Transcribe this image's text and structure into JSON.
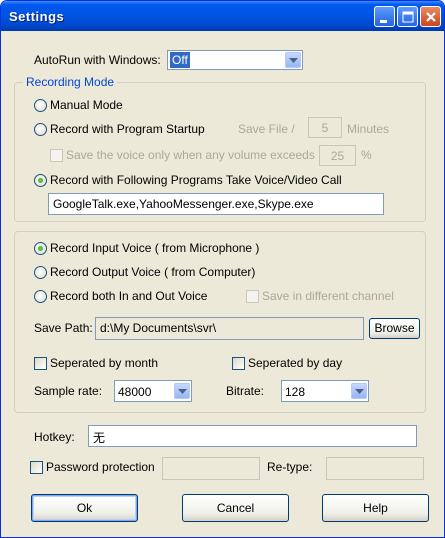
{
  "window": {
    "title": "Settings"
  },
  "autorun": {
    "label": "AutoRun with Windows:",
    "value": "Off"
  },
  "recording_mode": {
    "title": "Recording Mode",
    "manual": "Manual Mode",
    "startup": "Record with Program Startup",
    "save_file_label": "Save File /",
    "save_file_value": "5",
    "minutes_label": "Minutes",
    "volume_label": "Save the voice only when any volume exceeds",
    "volume_value": "25",
    "percent": "%",
    "programs": "Record with Following Programs Take Voice/Video Call",
    "programs_value": "GoogleTalk.exe,YahooMessenger.exe,Skype.exe",
    "selected": "programs"
  },
  "voice": {
    "input": "Record Input Voice ( from Microphone )",
    "output": "Record Output Voice ( from Computer)",
    "both": "Record both In and Out Voice",
    "diff_channel": "Save in different channel",
    "selected": "input"
  },
  "save_path": {
    "label": "Save Path:",
    "value": "d:\\My Documents\\svr\\",
    "browse": "Browse"
  },
  "separate": {
    "month": "Seperated by month",
    "day": "Seperated by day"
  },
  "sample_rate": {
    "label": "Sample rate:",
    "value": "48000"
  },
  "bitrate": {
    "label": "Bitrate:",
    "value": "128"
  },
  "hotkey": {
    "label": "Hotkey:",
    "value": "无"
  },
  "password": {
    "label": "Password protection",
    "retype_label": "Re-type:"
  },
  "buttons": {
    "ok": "Ok",
    "cancel": "Cancel",
    "help": "Help"
  },
  "colors": {
    "titlebar": "#0054E3",
    "dialog_bg": "#ECE9D8",
    "group_title": "#0046D5",
    "selection": "#316AC5"
  }
}
